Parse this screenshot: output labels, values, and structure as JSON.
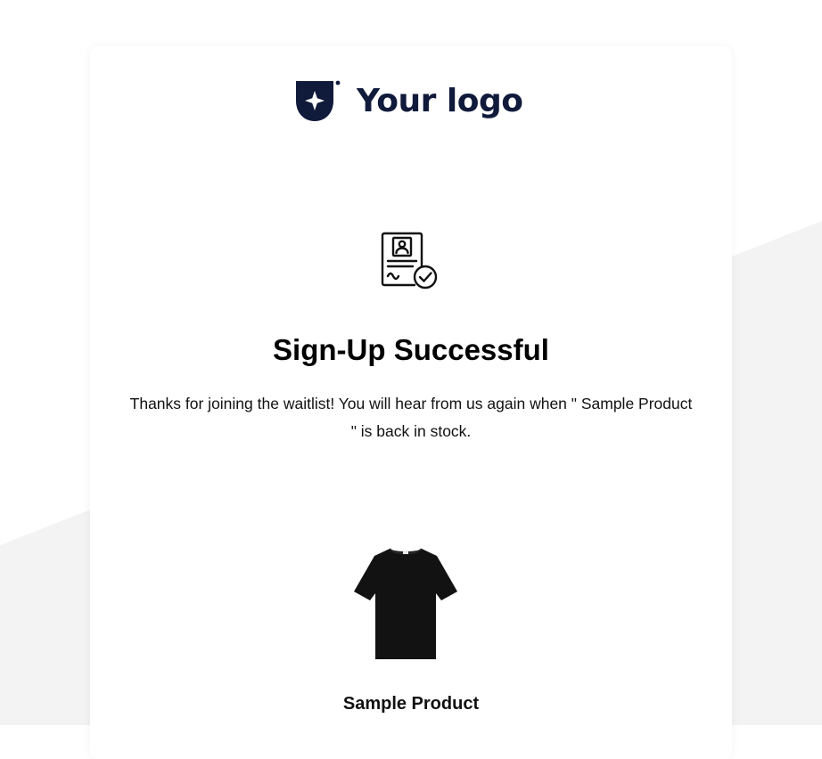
{
  "logo": {
    "text": "Your logo",
    "icon": "shield-star-icon",
    "color": "#101a3a"
  },
  "status": {
    "icon": "certificate-check-icon",
    "title": "Sign-Up Successful",
    "message": "Thanks for joining the waitlist! You will hear from us again when  \" Sample Product \" is back in stock."
  },
  "product": {
    "image": "black-tshirt",
    "name": "Sample Product"
  },
  "colors": {
    "background_shape": "#f3f3f4",
    "card": "#ffffff",
    "text": "#000000"
  }
}
